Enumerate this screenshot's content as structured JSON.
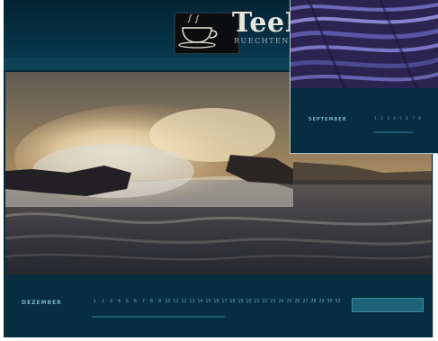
{
  "brand": {
    "name": "TeeP",
    "tagline": "RUECHTEN",
    "logo_icon": "teacup-icon"
  },
  "calendar_main": {
    "month": "DEZEMBER",
    "days": [
      "1",
      "2",
      "3",
      "4",
      "5",
      "6",
      "7",
      "8",
      "9",
      "10",
      "11",
      "12",
      "13",
      "14",
      "15",
      "16",
      "17",
      "18",
      "19",
      "20",
      "21",
      "22",
      "23",
      "24",
      "25",
      "26",
      "27",
      "28",
      "29",
      "30",
      "31"
    ],
    "photo": "ocean-wave-photo"
  },
  "calendar_card": {
    "month": "SEPTEMBER",
    "days": [
      "1",
      "2",
      "3",
      "4",
      "5",
      "6",
      "7",
      "8"
    ],
    "photo": "purple-texture-photo"
  },
  "colors": {
    "sheet": "#052a3c",
    "accent": "#7fb3c5",
    "button": "#1d6277"
  }
}
